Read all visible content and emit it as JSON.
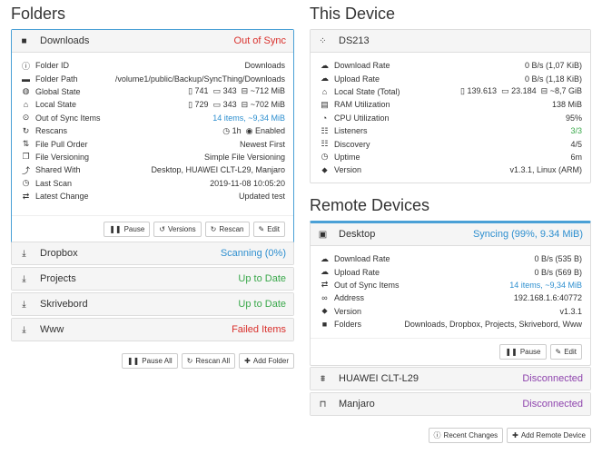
{
  "folders": {
    "heading": "Folders",
    "downloads": {
      "name": "Downloads",
      "status": "Out of Sync",
      "rows": [
        {
          "label": "Folder ID",
          "value": "Downloads"
        },
        {
          "label": "Folder Path",
          "value": "/volume1/public/Backup/SyncThing/Downloads"
        },
        {
          "label": "Global State",
          "files": "741",
          "dirs": "343",
          "size": "~712 MiB"
        },
        {
          "label": "Local State",
          "files": "729",
          "dirs": "343",
          "size": "~702 MiB"
        },
        {
          "label": "Out of Sync Items",
          "value": "14 items, ~9,34 MiB"
        },
        {
          "label": "Rescans",
          "value_a": "1h",
          "value_b": "Enabled"
        },
        {
          "label": "File Pull Order",
          "value": "Newest First"
        },
        {
          "label": "File Versioning",
          "value": "Simple File Versioning"
        },
        {
          "label": "Shared With",
          "value": "Desktop, HUAWEI CLT-L29, Manjaro"
        },
        {
          "label": "Last Scan",
          "value": "2019-11-08 10:05:20"
        },
        {
          "label": "Latest Change",
          "value": "Updated test"
        }
      ],
      "buttons": {
        "pause": "Pause",
        "versions": "Versions",
        "rescan": "Rescan",
        "edit": "Edit"
      }
    },
    "others": [
      {
        "name": "Dropbox",
        "status": "Scanning (0%)",
        "color": "#2e8fcf"
      },
      {
        "name": "Projects",
        "status": "Up to Date",
        "color": "#3aa84b"
      },
      {
        "name": "Skrivebord",
        "status": "Up to Date",
        "color": "#3aa84b"
      },
      {
        "name": "Www",
        "status": "Failed Items",
        "color": "#d9302c"
      }
    ],
    "footer": {
      "pause_all": "Pause All",
      "rescan_all": "Rescan All",
      "add_folder": "Add Folder"
    }
  },
  "this_device": {
    "heading": "This Device",
    "name": "DS213",
    "rows": [
      {
        "label": "Download Rate",
        "value": "0 B/s (1,07 KiB)"
      },
      {
        "label": "Upload Rate",
        "value": "0 B/s (1,18 KiB)"
      },
      {
        "label": "Local State (Total)",
        "files": "139.613",
        "dirs": "23.184",
        "size": "~8,7 GiB"
      },
      {
        "label": "RAM Utilization",
        "value": "138 MiB"
      },
      {
        "label": "CPU Utilization",
        "value": "95%"
      },
      {
        "label": "Listeners",
        "value": "3/3"
      },
      {
        "label": "Discovery",
        "value": "4/5"
      },
      {
        "label": "Uptime",
        "value": "6m"
      },
      {
        "label": "Version",
        "value": "v1.3.1, Linux (ARM)"
      }
    ]
  },
  "remote_devices": {
    "heading": "Remote Devices",
    "desktop": {
      "name": "Desktop",
      "status": "Syncing (99%, 9.34 MiB)",
      "rows": [
        {
          "label": "Download Rate",
          "value": "0 B/s (535 B)"
        },
        {
          "label": "Upload Rate",
          "value": "0 B/s (569 B)"
        },
        {
          "label": "Out of Sync Items",
          "value": "14 items, ~9,34 MiB"
        },
        {
          "label": "Address",
          "value": "192.168.1.6:40772"
        },
        {
          "label": "Version",
          "value": "v1.3.1"
        },
        {
          "label": "Folders",
          "value": "Downloads, Dropbox, Projects, Skrivebord, Www"
        }
      ],
      "buttons": {
        "pause": "Pause",
        "edit": "Edit"
      }
    },
    "others": [
      {
        "name": "HUAWEI CLT-L29",
        "status": "Disconnected",
        "color": "#8e44ad"
      },
      {
        "name": "Manjaro",
        "status": "Disconnected",
        "color": "#8e44ad"
      }
    ],
    "footer": {
      "recent_changes": "Recent Changes",
      "add_remote": "Add Remote Device"
    }
  }
}
